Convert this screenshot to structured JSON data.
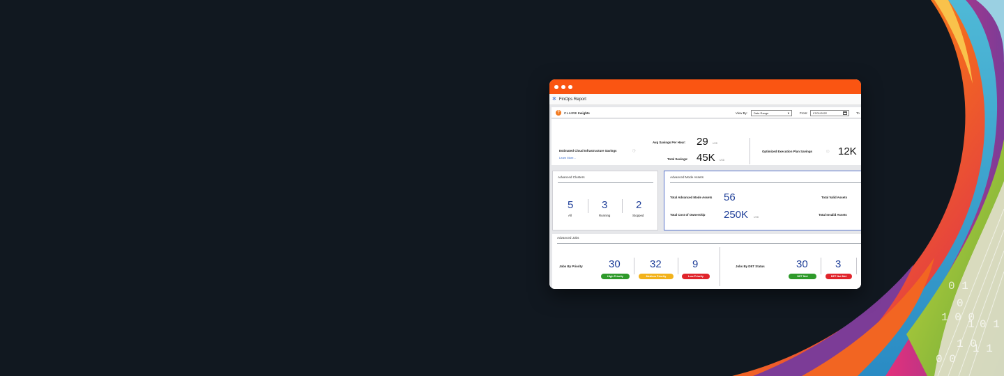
{
  "window": {
    "report_title": "FinOps Report"
  },
  "insights_bar": {
    "brand": "CLAIRE",
    "brand_suffix": "Insights",
    "view_by_label": "View By:",
    "view_by_value": "Date Range",
    "from_label": "From:",
    "from_value": "07/01/2022",
    "to_label_partial": "To"
  },
  "savings": {
    "title": "Estimated Cloud Infrastructure Savings",
    "learn_more": "Learn More...",
    "avg_label": "Avg Savings Per Hour:",
    "avg_value": "29",
    "avg_unit": "USD",
    "total_label": "Total Savings:",
    "total_value": "45K",
    "total_unit": "USD",
    "optimized_label": "Optimized Execution Plan Savings",
    "optimized_value": "12K"
  },
  "clusters": {
    "title": "Advanced Clusters",
    "stats": [
      {
        "value": "5",
        "label": "All"
      },
      {
        "value": "3",
        "label": "Running"
      },
      {
        "value": "2",
        "label": "Stopped"
      }
    ]
  },
  "assets": {
    "title": "Advanced Mode Assets",
    "total_label": "Total Advanced Mode Assets",
    "total_value": "56",
    "cost_label": "Total Cost of Ownership",
    "cost_value": "250K",
    "cost_unit": "USD",
    "valid_label": "Total Valid Assets",
    "invalid_label": "Total Invalid Assets"
  },
  "jobs": {
    "title": "Advanced Jobs",
    "priority_label": "Jobs By Priority",
    "priority": [
      {
        "value": "30",
        "badge": "High Priority",
        "color": "#2e9a2a"
      },
      {
        "value": "32",
        "badge": "Medium Priority",
        "color": "#f2b21b"
      },
      {
        "value": "9",
        "badge": "Low Priority",
        "color": "#e0242b"
      }
    ],
    "det_label": "Jobs By DET Status",
    "det": [
      {
        "value": "30",
        "badge": "DET Met",
        "color": "#2e9a2a"
      },
      {
        "value": "3",
        "badge": "DET Not Met",
        "color": "#e0242b"
      }
    ]
  },
  "decoration": {
    "binary": [
      "0",
      "1",
      "1 0",
      "0 1",
      "1 1",
      "0 0",
      "1 0 0",
      "0 1"
    ]
  }
}
